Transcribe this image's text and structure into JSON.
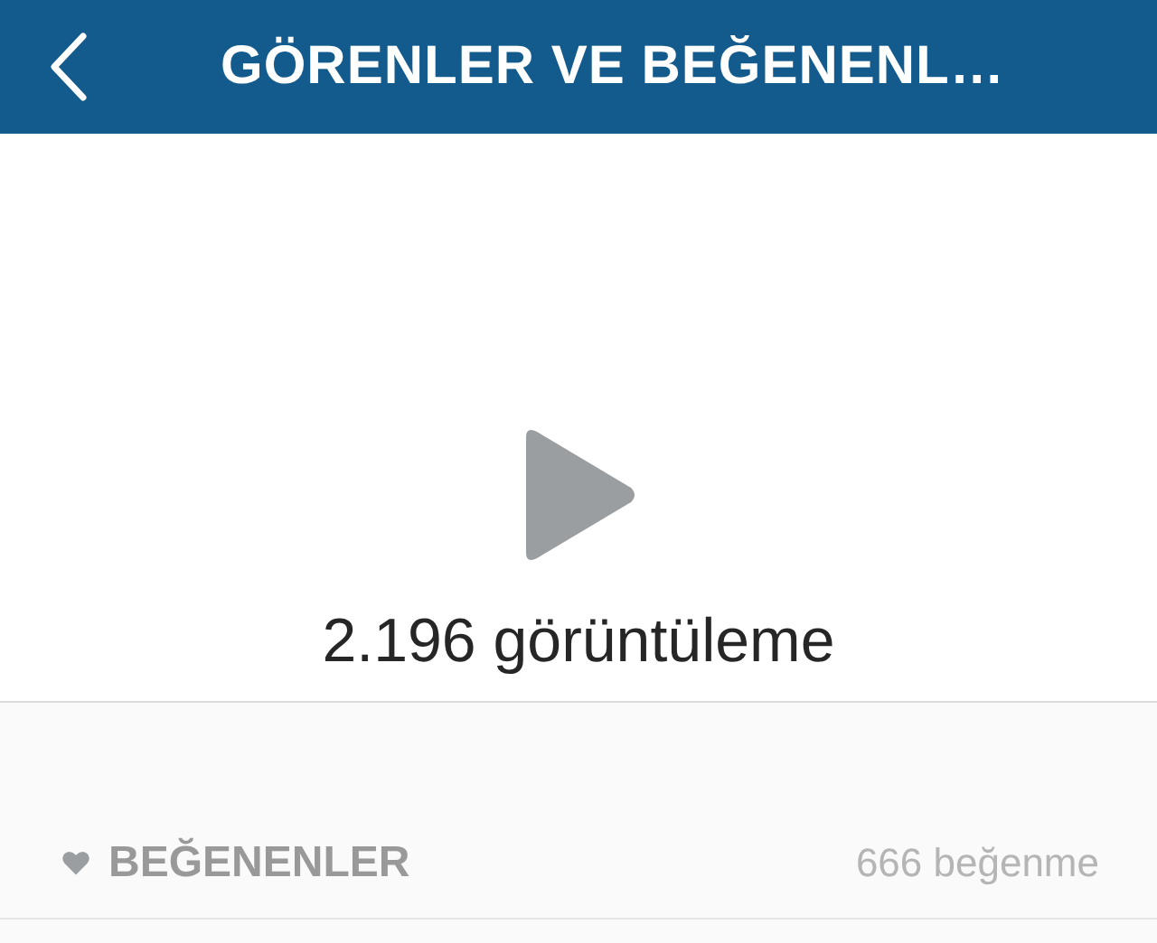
{
  "header": {
    "title": "GÖRENLER VE BEĞENENL…"
  },
  "video": {
    "views": "2.196 görüntüleme"
  },
  "likes_section": {
    "label": "BEĞENENLER",
    "count": "666 beğenme"
  }
}
